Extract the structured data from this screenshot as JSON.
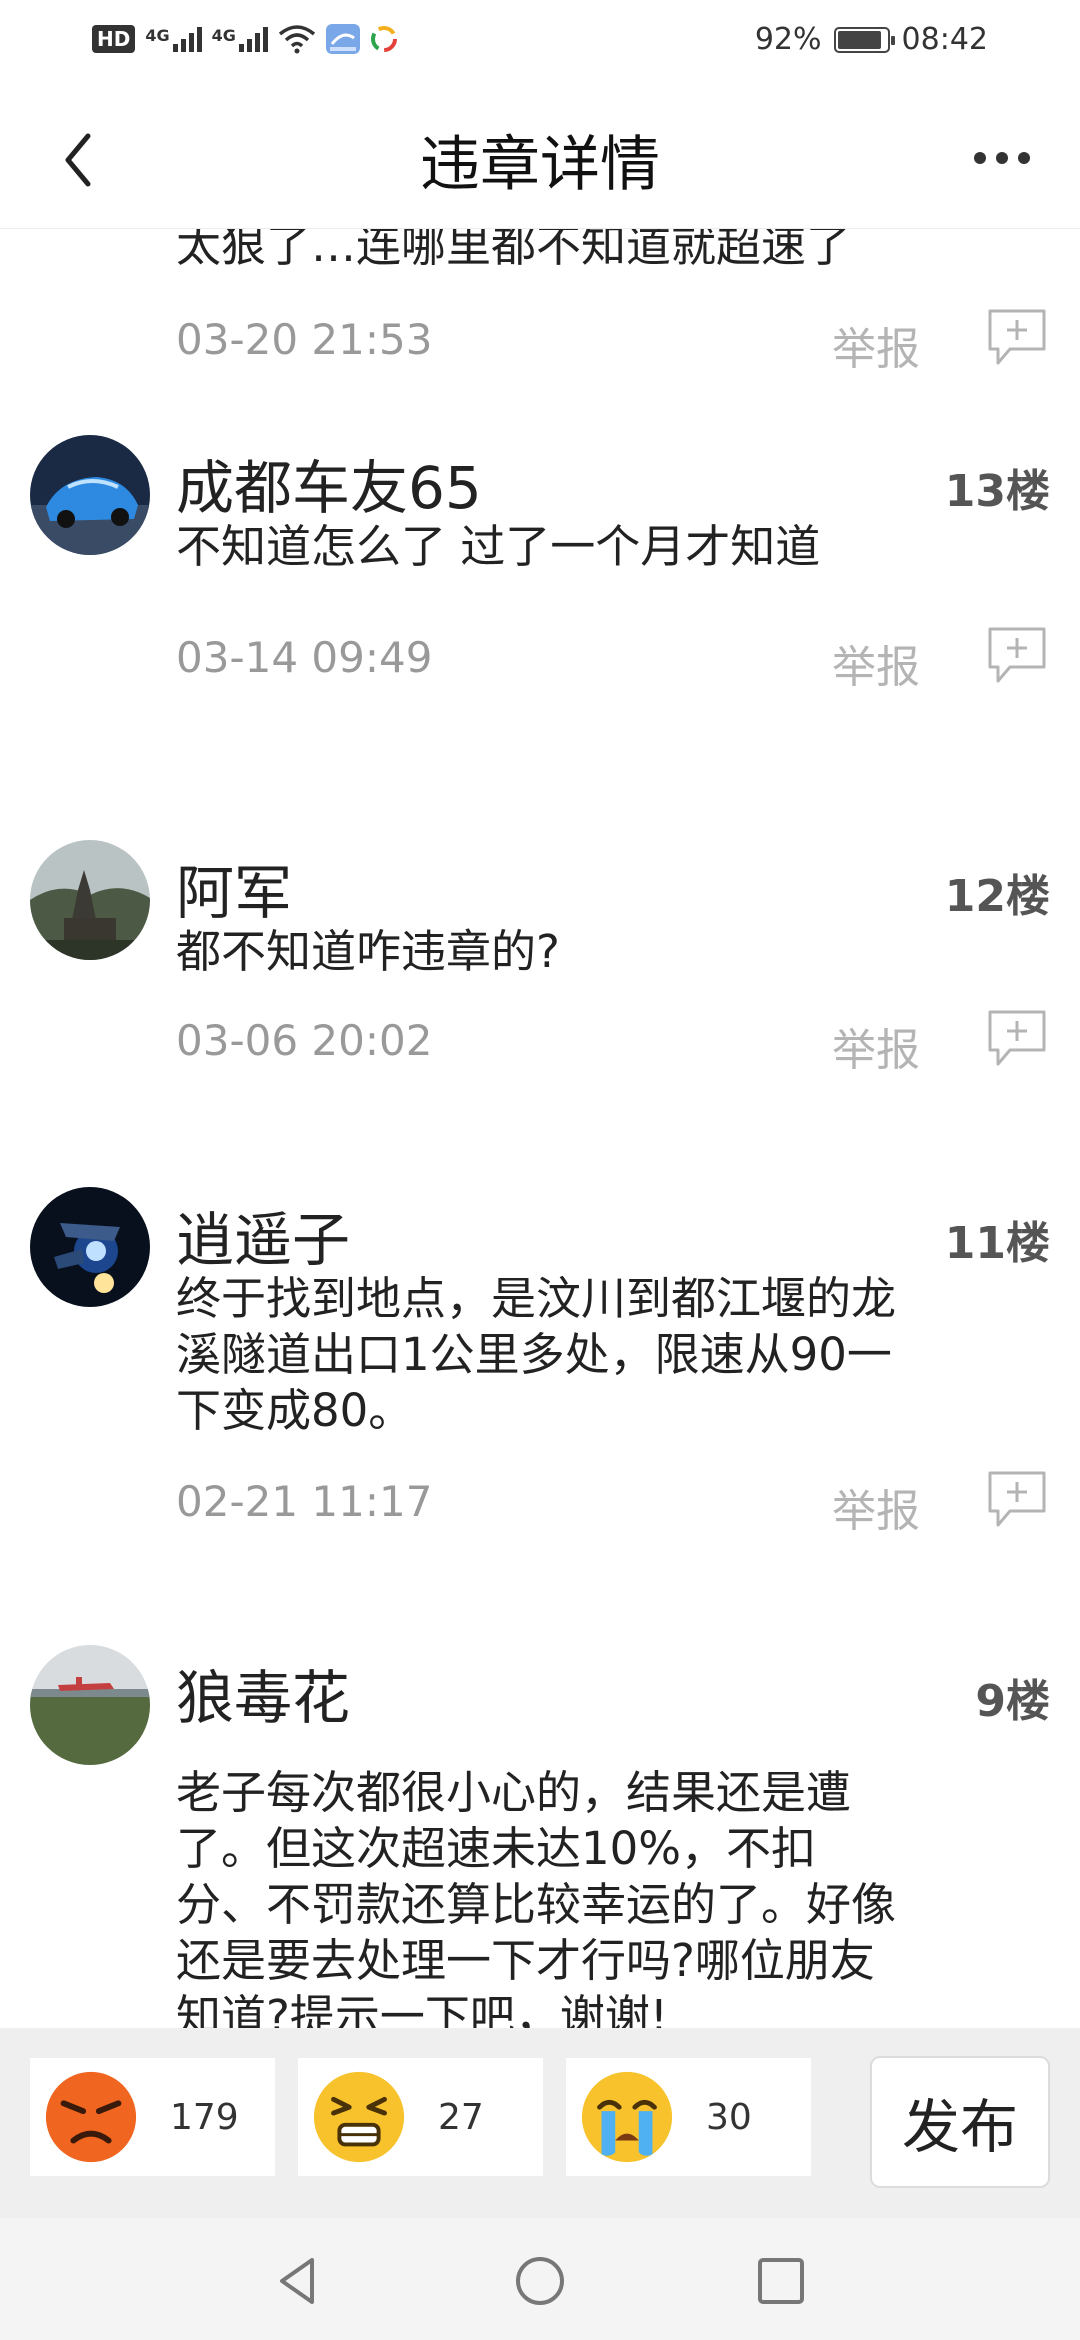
{
  "status_bar": {
    "hd": "HD",
    "net1": "4G",
    "net2": "4G",
    "battery_percent": "92%",
    "battery_level": 0.92,
    "time": "08:42"
  },
  "header": {
    "title": "违章详情"
  },
  "partial_comment": {
    "text": "太狠了…连哪里都不知道就超速了",
    "time": "03-20 21:53",
    "report": "举报"
  },
  "comments": [
    {
      "name": "成都车友65",
      "floor": "13楼",
      "body": "不知道怎么了 过了一个月才知道",
      "time": "03-14 09:49",
      "report": "举报"
    },
    {
      "name": "阿军",
      "floor": "12楼",
      "body": "都不知道咋违章的?",
      "time": "03-06 20:02",
      "report": "举报"
    },
    {
      "name": "逍遥子",
      "floor": "11楼",
      "body": "终于找到地点，是汶川到都江堰的龙溪隧道出口1公里多处，限速从90一下变成80。",
      "time": "02-21 11:17",
      "report": "举报"
    },
    {
      "name": "狼毒花",
      "floor": "9楼",
      "body": "老子每次都很小心的，结果还是遭了。但这次超速未达10%，不扣分、不罚款还算比较幸运的了。好像还是要去处理一下才行吗?哪位朋友知道?提示一下吧，谢谢!"
    }
  ],
  "reactions": [
    {
      "emoji": "angry-face",
      "count": "179"
    },
    {
      "emoji": "frustrated-face",
      "count": "27"
    },
    {
      "emoji": "crying-face",
      "count": "30"
    }
  ],
  "publish_label": "发布",
  "colors": {
    "report_gray": "#b4b4b4",
    "time_gray": "#999999",
    "bottom_bar_bg": "#efefef",
    "emoji_yellow": "#f7c22c",
    "emoji_angry": "#f0651f"
  }
}
